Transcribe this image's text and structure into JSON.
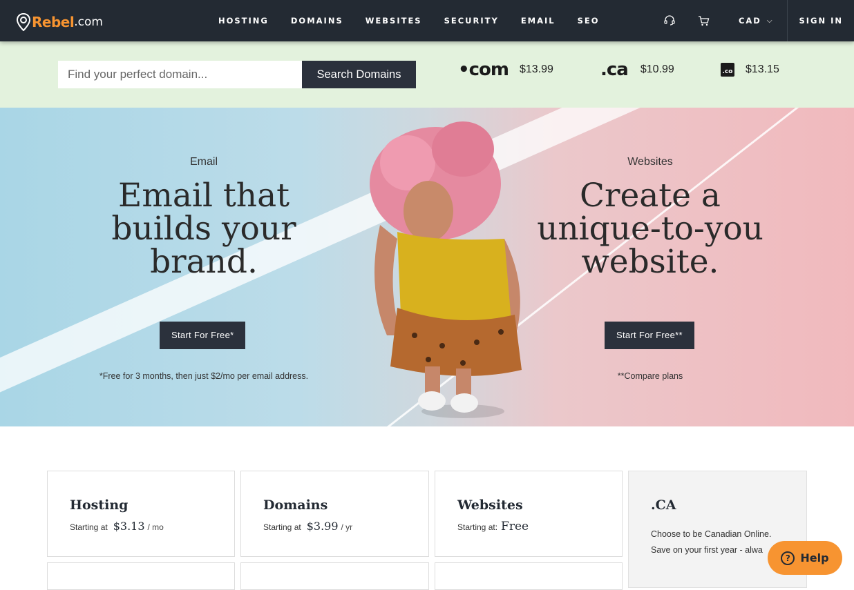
{
  "nav": {
    "logo_text": "Rebel",
    "logo_suffix": ".com",
    "links": [
      "HOSTING",
      "DOMAINS",
      "WEBSITES",
      "SECURITY",
      "EMAIL",
      "SEO"
    ],
    "currency": "CAD",
    "signin": "SIGN IN",
    "support_icon": "support-headset-icon",
    "cart_icon": "cart-icon"
  },
  "search": {
    "placeholder": "Find your perfect domain...",
    "button": "Search Domains",
    "tlds": [
      {
        "name": ".com",
        "logo": "•com",
        "price": "$13.99"
      },
      {
        "name": ".ca",
        "logo": ".ca",
        "price": "$10.99"
      },
      {
        "name": ".co",
        "logo": ".co",
        "price": "$13.15"
      }
    ]
  },
  "hero": {
    "left": {
      "eyebrow": "Email",
      "title": "Email that builds your brand.",
      "button": "Start For Free*",
      "note": "*Free for 3 months, then just $2/mo per email address."
    },
    "right": {
      "eyebrow": "Websites",
      "title": "Create a unique-to-you website.",
      "button": "Start For Free**",
      "note": "**Compare plans"
    }
  },
  "cards": [
    {
      "title": "Hosting",
      "prefix": "Starting at",
      "price": "$3.13",
      "unit": "/ mo"
    },
    {
      "title": "Domains",
      "prefix": "Starting at",
      "price": "$3.99",
      "unit": "/ yr"
    },
    {
      "title": "Websites",
      "prefix": "Starting at:",
      "price": "Free",
      "unit": ""
    },
    {
      "title": ".CA",
      "desc": "Choose to be Canadian Online. Save on your first year - alwa"
    }
  ],
  "help": {
    "label": "Help"
  },
  "colors": {
    "nav_bg": "#232a33",
    "accent": "#f79431",
    "strip_bg": "#e3f2dd",
    "button_dark": "#2b313c"
  }
}
